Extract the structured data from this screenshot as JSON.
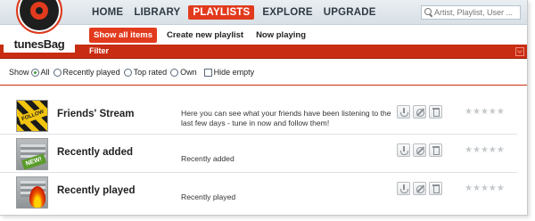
{
  "brand": {
    "name": "tunesBag",
    "accent_color": "#e23a1d",
    "bar_color": "#c82c12"
  },
  "nav": {
    "items": [
      {
        "label": "HOME",
        "active": false
      },
      {
        "label": "LIBRARY",
        "active": false
      },
      {
        "label": "PLAYLISTS",
        "active": true
      },
      {
        "label": "EXPLORE",
        "active": false
      },
      {
        "label": "UPGRADE",
        "active": false
      }
    ]
  },
  "search": {
    "placeholder": "Artist, Playlist, User ...",
    "icon": "search-icon"
  },
  "subnav": {
    "items": [
      {
        "label": "Show all items",
        "active": true
      },
      {
        "label": "Create new playlist",
        "active": false
      },
      {
        "label": "Now playing",
        "active": false
      }
    ]
  },
  "filter": {
    "label": "Filter",
    "show_label": "Show",
    "options": [
      {
        "label": "All",
        "checked": true
      },
      {
        "label": "Recently played",
        "checked": false
      },
      {
        "label": "Top rated",
        "checked": false
      },
      {
        "label": "Own",
        "checked": false
      }
    ],
    "hide_empty_label": "Hide empty",
    "hide_empty_checked": false
  },
  "playlists": [
    {
      "title": "Friends' Stream",
      "description": "Here you can see what your friends have been listening to the last few days - tune in now and follow them!",
      "thumb": "stream",
      "thumb_tag": "FOLLOW",
      "rating": 0
    },
    {
      "title": "Recently added",
      "description": "Recently added",
      "thumb": "added",
      "thumb_tag": "NEW!",
      "rating": 0
    },
    {
      "title": "Recently played",
      "description": "Recently played",
      "thumb": "played",
      "thumb_tag": "",
      "rating": 0
    }
  ],
  "row_actions": [
    "share-icon",
    "unsubscribe-icon",
    "trash-icon"
  ],
  "star_glyph": "★"
}
